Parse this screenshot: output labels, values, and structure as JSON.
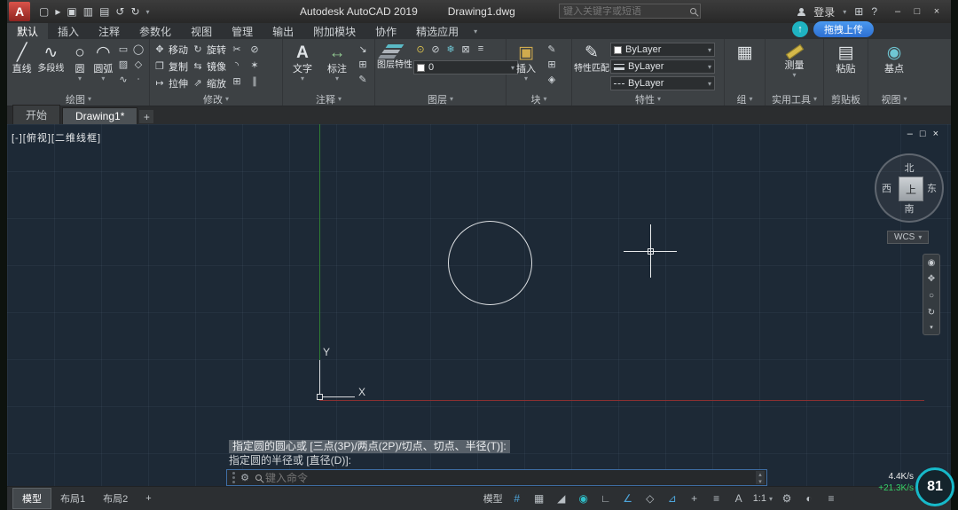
{
  "titlebar": {
    "logo": "A",
    "app_title": "Autodesk AutoCAD 2019",
    "doc_title": "Drawing1.dwg",
    "search_placeholder": "键入关键字或短语",
    "login": "登录"
  },
  "ribbon": {
    "tabs": [
      "默认",
      "插入",
      "注释",
      "参数化",
      "视图",
      "管理",
      "输出",
      "附加模块",
      "协作",
      "精选应用"
    ],
    "active_tab": "默认",
    "panels": {
      "draw": {
        "title": "绘图",
        "items": {
          "line": "直线",
          "polyline": "多段线",
          "circle": "圆",
          "arc": "圆弧"
        }
      },
      "modify": {
        "title": "修改",
        "items": {
          "move": "移动",
          "rotate": "旋转",
          "copy": "复制",
          "mirror": "镜像",
          "stretch": "拉伸",
          "scale": "缩放"
        }
      },
      "annotation": {
        "title": "注释",
        "items": {
          "text": "文字",
          "dimension": "标注"
        }
      },
      "layers": {
        "title": "图层",
        "items": {
          "layer_properties": "图层特性"
        },
        "current_layer": "0"
      },
      "block": {
        "title": "块",
        "items": {
          "insert": "插入"
        }
      },
      "properties": {
        "title": "特性",
        "items": {
          "match": "特性匹配"
        },
        "color": "ByLayer",
        "lineweight": "ByLayer",
        "linetype": "ByLayer"
      },
      "groups": {
        "title": "组"
      },
      "utilities": {
        "title": "实用工具",
        "items": {
          "measure": "测量"
        }
      },
      "clipboard": {
        "title": "剪贴板",
        "items": {
          "paste": "粘贴"
        }
      },
      "view": {
        "title": "视图",
        "items": {
          "base": "基点"
        }
      }
    }
  },
  "filetabs": {
    "start": "开始",
    "drawing": "Drawing1*",
    "add": "+"
  },
  "viewport": {
    "controls": "[-][俯视][二维线框]",
    "axis_x": "X",
    "axis_y": "Y"
  },
  "viewcube": {
    "north": "北",
    "south": "南",
    "west": "西",
    "east": "东",
    "top": "上",
    "wcs": "WCS"
  },
  "command": {
    "prompt1": "指定圆的圆心或 [三点(3P)/两点(2P)/切点、切点、半径(T)]:",
    "prompt2": "指定圆的半径或 [直径(D)]:",
    "input_placeholder": "键入命令"
  },
  "statusbar": {
    "model_tab": "模型",
    "layout1_tab": "布局1",
    "layout2_tab": "布局2",
    "add_layout": "+",
    "model_label": "模型",
    "annotation_scale": "1:1"
  },
  "overlay": {
    "upload_button": "拖拽上传",
    "upload_speed": "4.4K/s",
    "download_speed": "+21.3K/s",
    "battery_badge": "81"
  },
  "icons": {
    "dropdown": "▾",
    "new": "▢",
    "open": "▸",
    "save": "▣",
    "save_all": "▥",
    "print": "▤",
    "undo": "↺",
    "redo": "↻",
    "min": "–",
    "max": "□",
    "close": "×",
    "help": "?",
    "cart": "⊞",
    "line": "╱",
    "polyline": "∿",
    "circle": "○",
    "arc": "◠",
    "rectangle": "▭",
    "ellipse": "◯",
    "hatch": "▨",
    "polygon": "◇",
    "spline": "∿",
    "point": "∙",
    "move": "✥",
    "rotate": "↻",
    "copy": "❐",
    "mirror": "⇆",
    "stretch": "↦",
    "scale": "⇗",
    "trim": "✂",
    "fillet": "◝",
    "array": "⊞",
    "erase": "⊘",
    "explode": "✶",
    "offset": "∥",
    "text": "A",
    "dimension": "↔",
    "leader": "↘",
    "table": "⊞",
    "style": "✎",
    "insert": "▣",
    "block_edit": "✎",
    "block_create": "⊞",
    "attributes": "◈",
    "layer_a": "⊙",
    "layer_b": "⊘",
    "layer_c": "❄",
    "layer_d": "⊠",
    "layer_e": "≡",
    "group": "▦",
    "paste": "▤",
    "base": "◉",
    "grid": "#",
    "snap": "▦",
    "infer": "◢",
    "ortho": "∟",
    "polar": "∠",
    "iso": "◇",
    "osnap": "⊿",
    "dyn": "+",
    "lwt": "≡",
    "annovis": "A",
    "gear": "⚙",
    "isolate": "◐",
    "customize": "≡",
    "geoloc": "◉",
    "wheel": "◉",
    "pan": "✥",
    "zoom": "○",
    "orbit": "↻",
    "up": "▴",
    "down": "▾",
    "upload_arrow": "↑",
    "net_icon": "◆"
  },
  "colors": {
    "logo_red": "#b5332a",
    "accent_blue": "#3f8fe8",
    "badge_teal": "#17b9c9",
    "net_green": "#35d06a",
    "canvas_bg": "#1d2936",
    "axis_green": "#2e7d32",
    "axis_red": "#8a3032",
    "active_icon_blue": "#4ea6dc",
    "bylayer_swatch": "#ffffff"
  }
}
